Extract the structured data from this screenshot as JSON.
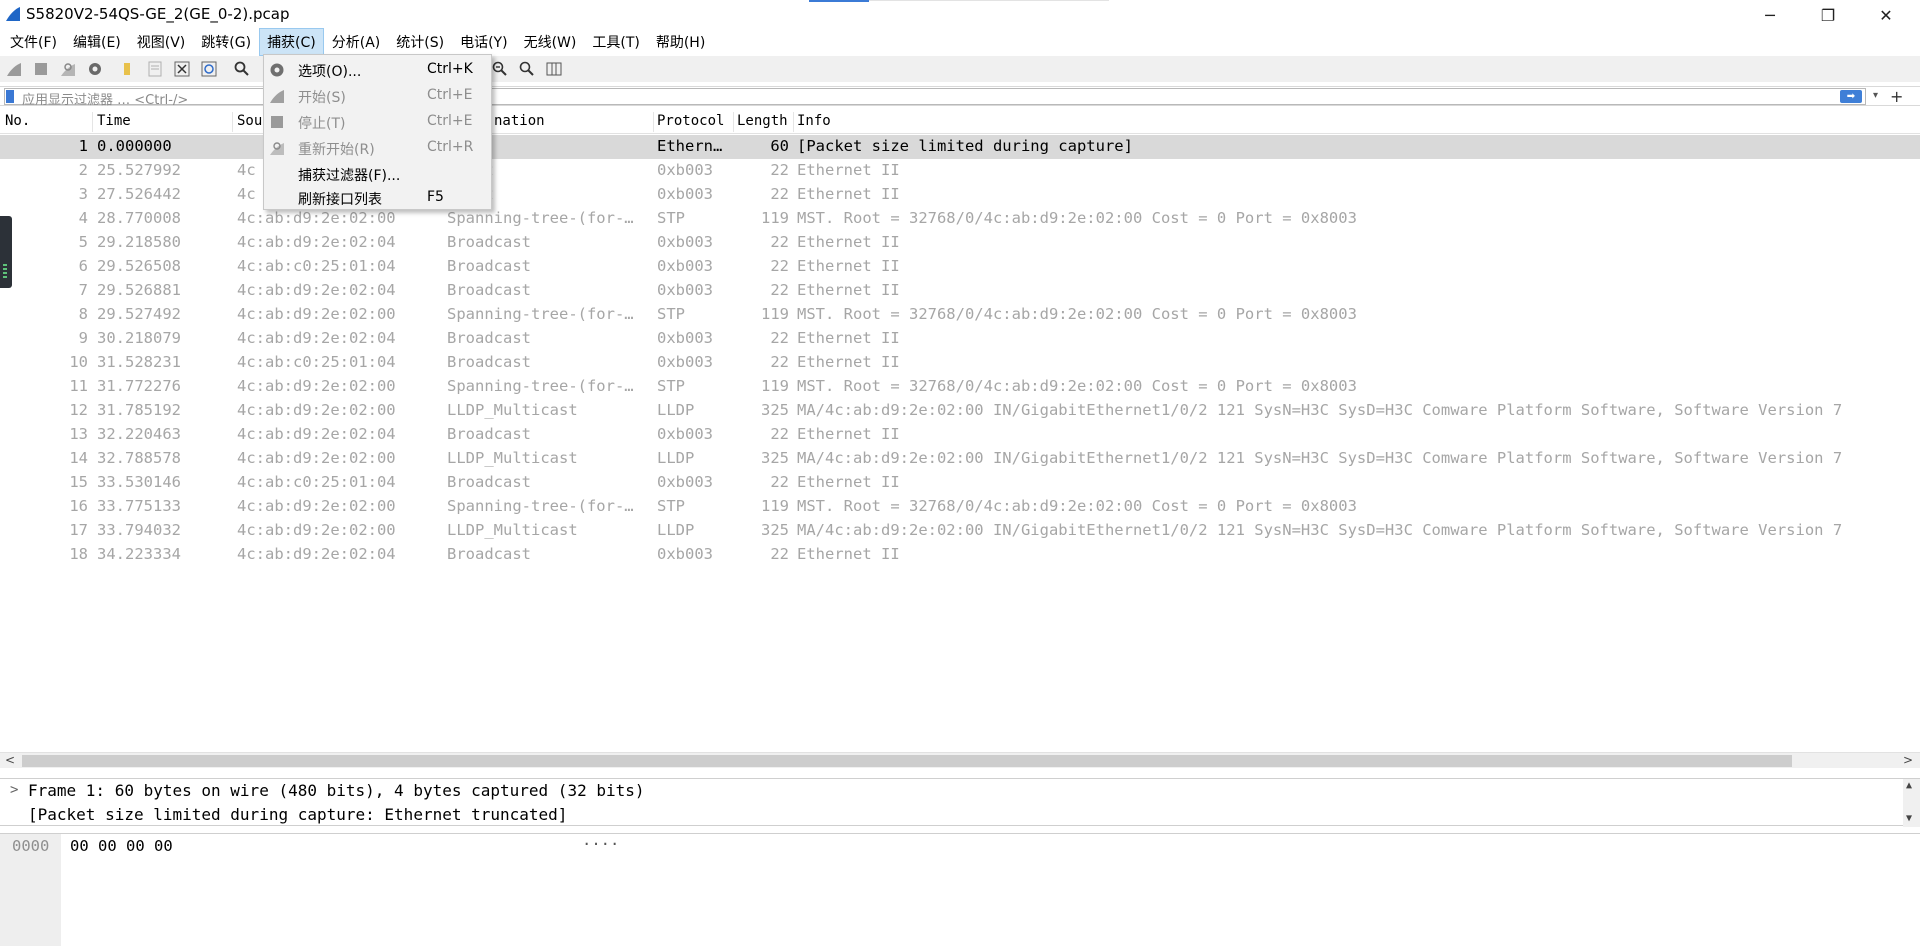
{
  "window": {
    "title": "S5820V2-54QS-GE_2(GE_0-2).pcap",
    "minimize": "─",
    "maximize": "❐",
    "close": "✕"
  },
  "menubar": [
    {
      "label": "文件(F)"
    },
    {
      "label": "编辑(E)"
    },
    {
      "label": "视图(V)"
    },
    {
      "label": "跳转(G)"
    },
    {
      "label": "捕获(C)"
    },
    {
      "label": "分析(A)"
    },
    {
      "label": "统计(S)"
    },
    {
      "label": "电话(Y)"
    },
    {
      "label": "无线(W)"
    },
    {
      "label": "工具(T)"
    },
    {
      "label": "帮助(H)"
    }
  ],
  "capture_menu": [
    {
      "label": "选项(O)...",
      "shortcut": "Ctrl+K",
      "icon": "gear-icon",
      "enabled": true
    },
    {
      "label": "开始(S)",
      "shortcut": "Ctrl+E",
      "icon": "shark-fin-icon",
      "enabled": false
    },
    {
      "label": "停止(T)",
      "shortcut": "Ctrl+E",
      "icon": "stop-square-icon",
      "enabled": false
    },
    {
      "label": "重新开始(R)",
      "shortcut": "Ctrl+R",
      "icon": "restart-icon",
      "enabled": false
    },
    {
      "label": "捕获过滤器(F)...",
      "shortcut": "",
      "icon": "",
      "enabled": true
    },
    {
      "label": "刷新接口列表",
      "shortcut": "F5",
      "icon": "",
      "enabled": true
    }
  ],
  "filter": {
    "placeholder": "应用显示过滤器 … <Ctrl-/>",
    "apply_icon": "arrow-right-icon"
  },
  "columns": {
    "no": "No.",
    "time": "Time",
    "source": "Sou",
    "destination": "nation",
    "protocol": "Protocol",
    "length": "Length",
    "info": "Info"
  },
  "packets": [
    {
      "no": "1",
      "time": "0.000000",
      "src": "",
      "dst": "",
      "proto": "Ethern…",
      "len": "60",
      "info": "[Packet size limited during capture]"
    },
    {
      "no": "2",
      "time": "25.527992",
      "src": "4c",
      "dst": "dcast",
      "proto": "0xb003",
      "len": "22",
      "info": "Ethernet II"
    },
    {
      "no": "3",
      "time": "27.526442",
      "src": "4c",
      "dst": "dcast",
      "proto": "0xb003",
      "len": "22",
      "info": "Ethernet II"
    },
    {
      "no": "4",
      "time": "28.770008",
      "src": "4c:ab:d9:2e:02:00",
      "dst": "Spanning-tree-(for-…",
      "proto": "STP",
      "len": "119",
      "info": "MST. Root = 32768/0/4c:ab:d9:2e:02:00  Cost = 0  Port = 0x8003"
    },
    {
      "no": "5",
      "time": "29.218580",
      "src": "4c:ab:d9:2e:02:04",
      "dst": "Broadcast",
      "proto": "0xb003",
      "len": "22",
      "info": "Ethernet II"
    },
    {
      "no": "6",
      "time": "29.526508",
      "src": "4c:ab:c0:25:01:04",
      "dst": "Broadcast",
      "proto": "0xb003",
      "len": "22",
      "info": "Ethernet II"
    },
    {
      "no": "7",
      "time": "29.526881",
      "src": "4c:ab:d9:2e:02:04",
      "dst": "Broadcast",
      "proto": "0xb003",
      "len": "22",
      "info": "Ethernet II"
    },
    {
      "no": "8",
      "time": "29.527492",
      "src": "4c:ab:d9:2e:02:00",
      "dst": "Spanning-tree-(for-…",
      "proto": "STP",
      "len": "119",
      "info": "MST. Root = 32768/0/4c:ab:d9:2e:02:00  Cost = 0  Port = 0x8003"
    },
    {
      "no": "9",
      "time": "30.218079",
      "src": "4c:ab:d9:2e:02:04",
      "dst": "Broadcast",
      "proto": "0xb003",
      "len": "22",
      "info": "Ethernet II"
    },
    {
      "no": "10",
      "time": "31.528231",
      "src": "4c:ab:c0:25:01:04",
      "dst": "Broadcast",
      "proto": "0xb003",
      "len": "22",
      "info": "Ethernet II"
    },
    {
      "no": "11",
      "time": "31.772276",
      "src": "4c:ab:d9:2e:02:00",
      "dst": "Spanning-tree-(for-…",
      "proto": "STP",
      "len": "119",
      "info": "MST. Root = 32768/0/4c:ab:d9:2e:02:00  Cost = 0  Port = 0x8003"
    },
    {
      "no": "12",
      "time": "31.785192",
      "src": "4c:ab:d9:2e:02:00",
      "dst": "LLDP_Multicast",
      "proto": "LLDP",
      "len": "325",
      "info": "MA/4c:ab:d9:2e:02:00 IN/GigabitEthernet1/0/2 121 SysN=H3C SysD=H3C Comware Platform Software, Software Version 7"
    },
    {
      "no": "13",
      "time": "32.220463",
      "src": "4c:ab:d9:2e:02:04",
      "dst": "Broadcast",
      "proto": "0xb003",
      "len": "22",
      "info": "Ethernet II"
    },
    {
      "no": "14",
      "time": "32.788578",
      "src": "4c:ab:d9:2e:02:00",
      "dst": "LLDP_Multicast",
      "proto": "LLDP",
      "len": "325",
      "info": "MA/4c:ab:d9:2e:02:00 IN/GigabitEthernet1/0/2 121 SysN=H3C SysD=H3C Comware Platform Software, Software Version 7"
    },
    {
      "no": "15",
      "time": "33.530146",
      "src": "4c:ab:c0:25:01:04",
      "dst": "Broadcast",
      "proto": "0xb003",
      "len": "22",
      "info": "Ethernet II"
    },
    {
      "no": "16",
      "time": "33.775133",
      "src": "4c:ab:d9:2e:02:00",
      "dst": "Spanning-tree-(for-…",
      "proto": "STP",
      "len": "119",
      "info": "MST. Root = 32768/0/4c:ab:d9:2e:02:00  Cost = 0  Port = 0x8003"
    },
    {
      "no": "17",
      "time": "33.794032",
      "src": "4c:ab:d9:2e:02:00",
      "dst": "LLDP_Multicast",
      "proto": "LLDP",
      "len": "325",
      "info": "MA/4c:ab:d9:2e:02:00 IN/GigabitEthernet1/0/2 121 SysN=H3C SysD=H3C Comware Platform Software, Software Version 7"
    },
    {
      "no": "18",
      "time": "34.223334",
      "src": "4c:ab:d9:2e:02:04",
      "dst": "Broadcast",
      "proto": "0xb003",
      "len": "22",
      "info": "Ethernet II"
    }
  ],
  "details": {
    "line1": "Frame 1: 60 bytes on wire (480 bits), 4 bytes captured (32 bits)",
    "line2": "[Packet size limited during capture: Ethernet truncated]"
  },
  "bytes": {
    "offset": "0000",
    "hex": "00 00 00 00",
    "ascii": "····"
  },
  "colors": {
    "selected_row": "#d9d9d9",
    "menu_open": "#cce4f7",
    "accent": "#3f7fd7"
  }
}
